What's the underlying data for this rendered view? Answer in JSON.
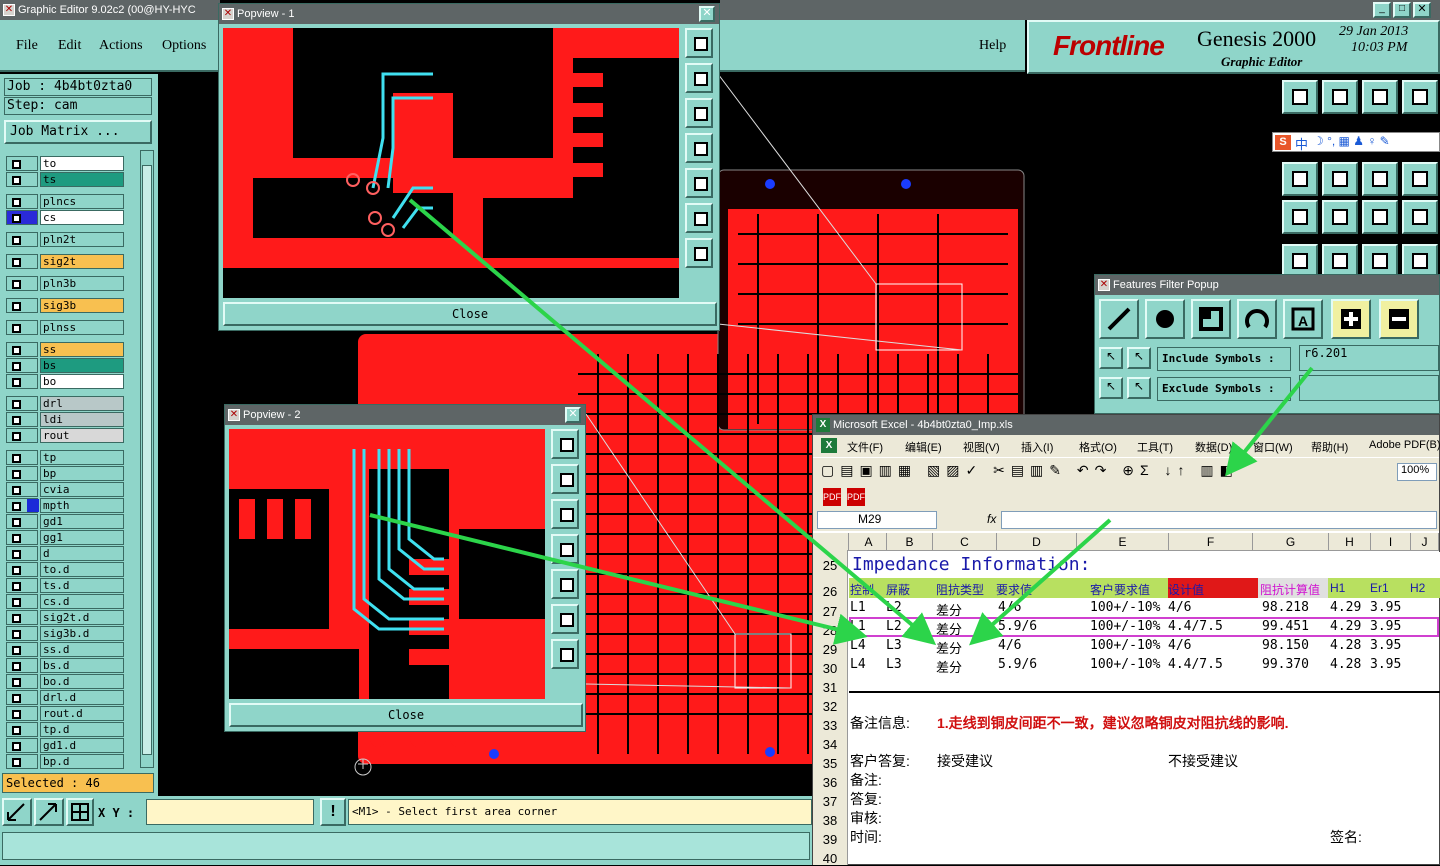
{
  "app": {
    "title": "Graphic Editor 9.02c2 (00@HY-HYC",
    "menu": [
      "File",
      "Edit",
      "Actions",
      "Options"
    ],
    "help": "Help"
  },
  "brand": {
    "logo": "Frontline",
    "product": "Genesis 2000",
    "subtitle": "Graphic Editor",
    "date": "29 Jan 2013",
    "time": "10:03 PM"
  },
  "job": {
    "job": "Job : 4b4bt0zta0",
    "step": "Step: cam",
    "matrix": "Job Matrix ..."
  },
  "layers": [
    "to",
    "ts",
    "plncs",
    "cs",
    "pln2t",
    "sig2t",
    "pln3b",
    "sig3b",
    "plnss",
    "ss",
    "bs",
    "bo",
    "drl",
    "ldi",
    "rout",
    "tp",
    "bp",
    "cvia",
    "mpth",
    "gd1",
    "gg1",
    "d",
    "to.d",
    "ts.d",
    "cs.d",
    "sig2t.d",
    "sig3b.d",
    "ss.d",
    "bs.d",
    "bo.d",
    "drl.d",
    "rout.d",
    "tp.d",
    "gd1.d",
    "bp.d"
  ],
  "selected": "Selected : 46",
  "status": {
    "xy": "X Y :",
    "message": "<M1> - Select first area corner",
    "warn": "!"
  },
  "popview1": {
    "title": "Popview - 1",
    "close": "Close"
  },
  "popview2": {
    "title": "Popview - 2",
    "close": "Close"
  },
  "filter": {
    "title": "Features Filter Popup",
    "include": "Include Symbols :",
    "include_val": "r6.201",
    "exclude": "Exclude Symbols :"
  },
  "ime": "中",
  "excel": {
    "title": "Microsoft Excel - 4b4bt0zta0_Imp.xls",
    "menu": [
      "文件(F)",
      "编辑(E)",
      "视图(V)",
      "插入(I)",
      "格式(O)",
      "工具(T)",
      "数据(D)",
      "窗口(W)",
      "帮助(H)",
      "Adobe PDF(B)"
    ],
    "zoom": "100%",
    "namebox": "M29",
    "fx": "fx",
    "cols": [
      "A",
      "B",
      "C",
      "D",
      "E",
      "F",
      "G",
      "H",
      "I",
      "J"
    ],
    "heading": "Impedance Information:",
    "hdr": [
      "控制",
      "屏蔽",
      "阻抗类型",
      "要求值",
      "客户要求值",
      "设计值",
      "阻抗计算值",
      "H1",
      "Er1",
      "H2"
    ],
    "rows": [
      [
        "L1",
        "L2",
        "差分",
        "4/6",
        "100+/-10%",
        "4/6",
        "98.218",
        "4.29",
        "3.95"
      ],
      [
        "L1",
        "L2",
        "差分",
        "5.9/6",
        "100+/-10%",
        "4.4/7.5",
        "99.451",
        "4.29",
        "3.95"
      ],
      [
        "L4",
        "L3",
        "差分",
        "4/6",
        "100+/-10%",
        "4/6",
        "98.150",
        "4.28",
        "3.95"
      ],
      [
        "L4",
        "L3",
        "差分",
        "5.9/6",
        "100+/-10%",
        "4.4/7.5",
        "99.370",
        "4.28",
        "3.95"
      ]
    ],
    "rownums": [
      "25",
      "26",
      "27",
      "28",
      "29",
      "30",
      "31",
      "32",
      "33",
      "34",
      "35",
      "36",
      "37",
      "38",
      "39",
      "40"
    ],
    "note_label": "备注信息:",
    "note": "1.走线到铜皮间距不一致，建议忽略铜皮对阻抗线的影响.",
    "reply_label": "客户答复:",
    "accept": "接受建议",
    "reject": "不接受建议",
    "remark": "备注:",
    "answer": "答复:",
    "review": "审核:",
    "time": "时间:",
    "sign": "签名:"
  }
}
